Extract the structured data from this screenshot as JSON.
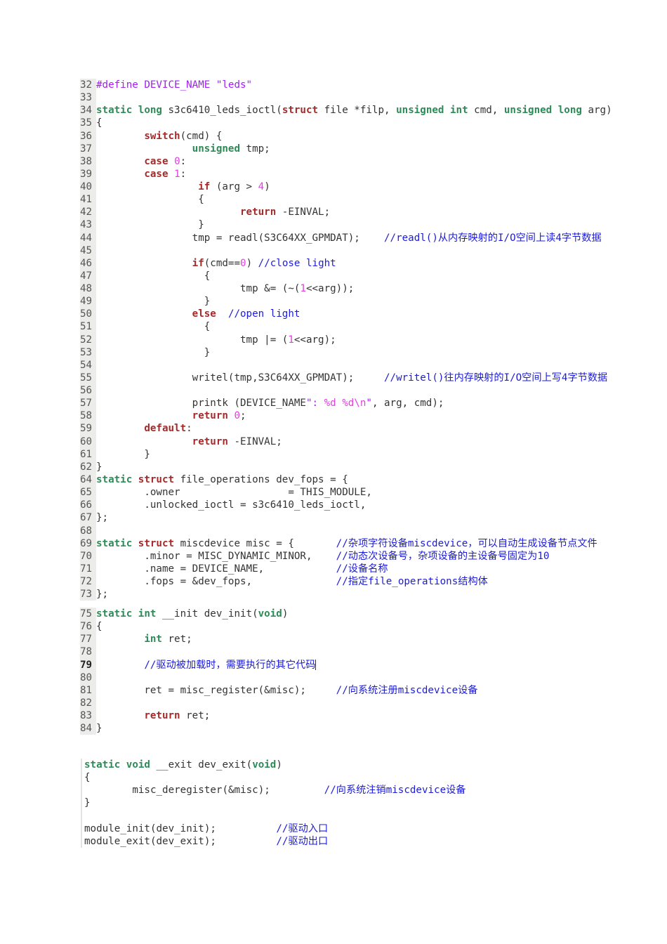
{
  "colors": {
    "keyword": "#a52a2a",
    "type": "#2e8b57",
    "preprocessor": "#a020f0",
    "number": "#e040e0",
    "comment": "#1c1cd8"
  },
  "blocks": [
    {
      "id": "b1",
      "lines": [
        {
          "n": "32",
          "s": [
            [
              "#define DEVICE_NAME \"leds\"",
              "p"
            ]
          ]
        },
        {
          "n": "33",
          "s": []
        },
        {
          "n": "34",
          "s": [
            [
              "static",
              "t"
            ],
            [
              " "
            ],
            [
              "long",
              "t"
            ],
            [
              " s3c6410_leds_ioctl("
            ],
            [
              "struct",
              "k"
            ],
            [
              " file *filp, "
            ],
            [
              "unsigned",
              "t"
            ],
            [
              " "
            ],
            [
              "int",
              "t"
            ],
            [
              " cmd, "
            ],
            [
              "unsigned",
              "t"
            ],
            [
              " "
            ],
            [
              "long",
              "t"
            ],
            [
              " arg)"
            ]
          ]
        },
        {
          "n": "35",
          "s": [
            [
              "{"
            ]
          ]
        },
        {
          "n": "36",
          "s": [
            [
              "\t"
            ],
            [
              "switch",
              "k"
            ],
            [
              "(cmd) {"
            ]
          ]
        },
        {
          "n": "37",
          "s": [
            [
              "\t\t"
            ],
            [
              "unsigned",
              "t"
            ],
            [
              " tmp;"
            ]
          ]
        },
        {
          "n": "38",
          "s": [
            [
              "\t"
            ],
            [
              "case",
              "k"
            ],
            [
              " "
            ],
            [
              "0",
              "n"
            ],
            [
              ":"
            ]
          ]
        },
        {
          "n": "39",
          "s": [
            [
              "\t"
            ],
            [
              "case",
              "k"
            ],
            [
              " "
            ],
            [
              "1",
              "n"
            ],
            [
              ":"
            ]
          ]
        },
        {
          "n": "40",
          "s": [
            [
              "\t\t "
            ],
            [
              "if",
              "k"
            ],
            [
              " (arg > "
            ],
            [
              "4",
              "n"
            ],
            [
              ")"
            ]
          ]
        },
        {
          "n": "41",
          "s": [
            [
              "\t\t {"
            ]
          ]
        },
        {
          "n": "42",
          "s": [
            [
              "\t\t\t"
            ],
            [
              "return",
              "k"
            ],
            [
              " -EINVAL;"
            ]
          ]
        },
        {
          "n": "43",
          "s": [
            [
              "\t\t }"
            ]
          ]
        },
        {
          "n": "44",
          "s": [
            [
              "\t\ttmp = readl(S3C64XX_GPMDAT);\t"
            ],
            [
              "//readl()从内存映射的I/O空间上读4字节数据",
              "c"
            ]
          ]
        },
        {
          "n": "45",
          "s": []
        },
        {
          "n": "46",
          "s": [
            [
              "\t\t"
            ],
            [
              "if",
              "k"
            ],
            [
              "(cmd=="
            ],
            [
              "0",
              "n"
            ],
            [
              ") "
            ],
            [
              "//close light",
              "c"
            ]
          ]
        },
        {
          "n": "47",
          "s": [
            [
              "\t\t  {"
            ]
          ]
        },
        {
          "n": "48",
          "s": [
            [
              "\t\t\ttmp &= (~("
            ],
            [
              "1",
              "n"
            ],
            [
              "<<arg));"
            ]
          ]
        },
        {
          "n": "49",
          "s": [
            [
              "\t\t  }"
            ]
          ]
        },
        {
          "n": "50",
          "s": [
            [
              "\t\t"
            ],
            [
              "else",
              "k"
            ],
            [
              "  "
            ],
            [
              "//open light",
              "c"
            ]
          ]
        },
        {
          "n": "51",
          "s": [
            [
              "\t\t  {"
            ]
          ]
        },
        {
          "n": "52",
          "s": [
            [
              "\t\t\ttmp |= ("
            ],
            [
              "1",
              "n"
            ],
            [
              "<<arg);"
            ]
          ]
        },
        {
          "n": "53",
          "s": [
            [
              "\t\t  }"
            ]
          ]
        },
        {
          "n": "54",
          "s": []
        },
        {
          "n": "55",
          "s": [
            [
              "\t\twritel(tmp,S3C64XX_GPMDAT);\t"
            ],
            [
              "//writel()往内存映射的I/O空间上写4字节数据",
              "c"
            ]
          ]
        },
        {
          "n": "56",
          "s": []
        },
        {
          "n": "57",
          "s": [
            [
              "\t\tprintk (DEVICE_NAME"
            ],
            [
              "\": ",
              "p"
            ],
            [
              "%d %d\\n",
              "n"
            ],
            [
              "\"",
              "p"
            ],
            [
              ", arg, cmd);"
            ]
          ]
        },
        {
          "n": "58",
          "s": [
            [
              "\t\t"
            ],
            [
              "return",
              "k"
            ],
            [
              " "
            ],
            [
              "0",
              "n"
            ],
            [
              ";"
            ]
          ]
        },
        {
          "n": "59",
          "s": [
            [
              "\t"
            ],
            [
              "default",
              "k"
            ],
            [
              ":"
            ]
          ]
        },
        {
          "n": "60",
          "s": [
            [
              "\t\t"
            ],
            [
              "return",
              "k"
            ],
            [
              " -EINVAL;"
            ]
          ]
        },
        {
          "n": "61",
          "s": [
            [
              "\t}"
            ]
          ]
        },
        {
          "n": "62",
          "s": [
            [
              "}"
            ]
          ]
        }
      ]
    },
    {
      "id": "b2",
      "lines": [
        {
          "n": "64",
          "s": [
            [
              "static",
              "t"
            ],
            [
              " "
            ],
            [
              "struct",
              "k"
            ],
            [
              " file_operations dev_fops = {"
            ]
          ]
        },
        {
          "n": "65",
          "s": [
            [
              "\t.owner\t\t\t= THIS_MODULE,"
            ]
          ]
        },
        {
          "n": "66",
          "s": [
            [
              "\t.unlocked_ioctl = s3c6410_leds_ioctl,"
            ]
          ]
        },
        {
          "n": "67",
          "s": [
            [
              "};"
            ]
          ]
        },
        {
          "n": "68",
          "s": []
        },
        {
          "n": "69",
          "s": [
            [
              "static",
              "t"
            ],
            [
              " "
            ],
            [
              "struct",
              "k"
            ],
            [
              " miscdevice misc = {\t"
            ],
            [
              "//杂项字符设备miscdevice，可以自动生成设备节点文件",
              "c"
            ]
          ]
        },
        {
          "n": "70",
          "s": [
            [
              "\t.minor = MISC_DYNAMIC_MINOR,\t"
            ],
            [
              "//动态次设备号，杂项设备的主设备号固定为10",
              "c"
            ]
          ]
        },
        {
          "n": "71",
          "s": [
            [
              "\t.name = DEVICE_NAME,\t\t"
            ],
            [
              "//设备名称",
              "c"
            ]
          ]
        },
        {
          "n": "72",
          "s": [
            [
              "\t.fops = &dev_fops,\t\t"
            ],
            [
              "//指定file_operations结构体",
              "c"
            ]
          ]
        },
        {
          "n": "73",
          "s": [
            [
              "};"
            ]
          ]
        }
      ]
    },
    {
      "id": "b3",
      "lines": [
        {
          "n": "75",
          "s": [
            [
              "static",
              "t"
            ],
            [
              " "
            ],
            [
              "int",
              "t"
            ],
            [
              " __init dev_init("
            ],
            [
              "void",
              "t"
            ],
            [
              ")"
            ]
          ]
        },
        {
          "n": "76",
          "s": [
            [
              "{"
            ]
          ]
        },
        {
          "n": "77",
          "s": [
            [
              "\t"
            ],
            [
              "int",
              "t"
            ],
            [
              " ret;"
            ]
          ]
        },
        {
          "n": "78",
          "s": []
        },
        {
          "n": "79",
          "bold": true,
          "cursor": true,
          "s": [
            [
              "\t"
            ],
            [
              "//驱动被加载时，需要执行的其它代码",
              "c"
            ]
          ]
        },
        {
          "n": "80",
          "s": []
        },
        {
          "n": "81",
          "s": [
            [
              "\tret = misc_register(&misc);\t"
            ],
            [
              "//向系统注册miscdevice设备",
              "c"
            ]
          ]
        },
        {
          "n": "82",
          "s": []
        },
        {
          "n": "83",
          "s": [
            [
              "\t"
            ],
            [
              "return",
              "k"
            ],
            [
              " ret;"
            ]
          ]
        },
        {
          "n": "84",
          "s": [
            [
              "}"
            ]
          ]
        }
      ]
    },
    {
      "id": "b4",
      "lines": [
        {
          "s": [
            [
              "static",
              "t"
            ],
            [
              " "
            ],
            [
              "void",
              "t"
            ],
            [
              " __exit dev_exit("
            ],
            [
              "void",
              "t"
            ],
            [
              ")"
            ]
          ]
        },
        {
          "s": [
            [
              "{"
            ]
          ]
        },
        {
          "s": [
            [
              "\tmisc_deregister(&misc);\t\t"
            ],
            [
              "//向系统注销miscdevice设备",
              "c"
            ]
          ]
        },
        {
          "s": [
            [
              "}"
            ]
          ]
        },
        {
          "s": []
        },
        {
          "s": [
            [
              "module_init(dev_init);\t\t"
            ],
            [
              "//驱动入口",
              "c"
            ]
          ]
        },
        {
          "s": [
            [
              "module_exit(dev_exit);\t\t"
            ],
            [
              "//驱动出口",
              "c"
            ]
          ]
        }
      ]
    }
  ]
}
